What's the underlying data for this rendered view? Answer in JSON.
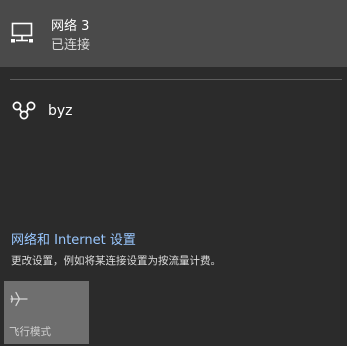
{
  "connection": {
    "name": "网络 3",
    "status": "已连接",
    "icon": "wired-network-icon"
  },
  "vpn": {
    "name": "byz",
    "icon": "vpn-icon"
  },
  "settings": {
    "link_label": "网络和 Internet 设置",
    "description": "更改设置，例如将某连接设置为按流量计费。"
  },
  "quick_actions": [
    {
      "label": "飞行模式",
      "icon": "airplane-icon"
    }
  ],
  "colors": {
    "background": "#2b2b2b",
    "selected_item": "#4a4a4a",
    "link": "#99c7ff",
    "tile": "#6f6f6f"
  }
}
